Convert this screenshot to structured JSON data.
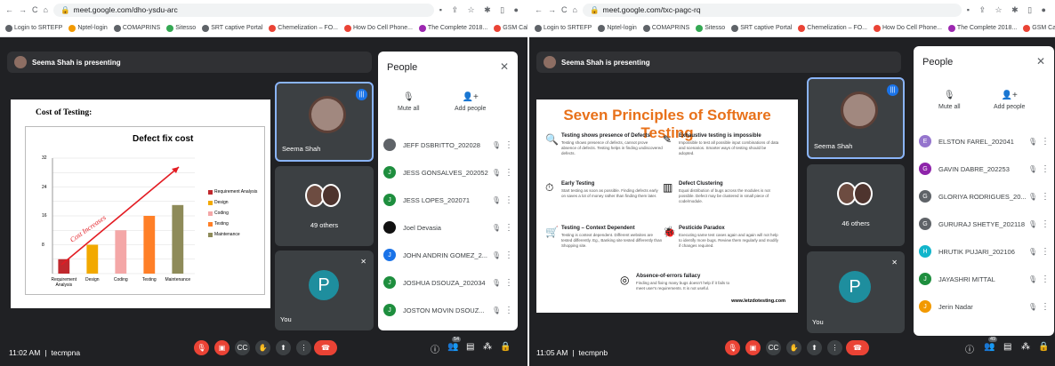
{
  "screen1": {
    "nav_icons": [
      "←",
      "→",
      "C",
      "⌂"
    ],
    "url": "meet.google.com/dho-ysdu-arc",
    "bookmarks": [
      {
        "label": "Login to SRTEFP",
        "color": "#5f6368"
      },
      {
        "label": "Nptel-login",
        "color": "#f29900"
      },
      {
        "label": "COMAPRINS",
        "color": "#5f6368"
      },
      {
        "label": "Sitesso",
        "color": "#34a853"
      },
      {
        "label": "SRT captive Portal",
        "color": "#5f6368"
      },
      {
        "label": "Chemelization – FO...",
        "color": "#ea4335"
      },
      {
        "label": "How Do Cell Phone...",
        "color": "#ea4335"
      },
      {
        "label": "The Complete 2018...",
        "color": "#9c27b0"
      },
      {
        "label": "GSM Call Flow 1 – Y...",
        "color": "#ea4335"
      },
      {
        "label": "2NE",
        "color": "#1a73e8"
      }
    ],
    "presenting": "Seema Shah is presenting",
    "slide_title": "Cost of Testing:",
    "chart_data": {
      "type": "bar",
      "title": "Defect fix cost",
      "categories": [
        "Requirement Analysis",
        "Design",
        "Coding",
        "Testing",
        "Maintenance"
      ],
      "values": [
        4,
        8,
        12,
        16,
        19
      ],
      "colors": [
        "#c0282d",
        "#f2a900",
        "#f4a7a7",
        "#ff7f27",
        "#8e8b59"
      ],
      "ylim": [
        0,
        32
      ],
      "yticks": [
        0,
        4,
        8,
        12,
        16,
        20,
        24,
        28,
        32
      ],
      "ytick_labels": [
        "",
        "",
        "8",
        "",
        "16",
        "",
        "24",
        "",
        "32"
      ],
      "annotation": "Cost Increases",
      "legend": [
        "Requirement Analysis",
        "Design",
        "Coding",
        "Testing",
        "Maintenance"
      ]
    },
    "tile_names": {
      "presenter": "Seema Shah",
      "others": "49 others",
      "you": "You"
    },
    "you_initial": "P",
    "people": {
      "title": "People",
      "close": "✕",
      "mute_all": "Mute all",
      "add_people": "Add people",
      "rows": [
        {
          "initial": "",
          "name": "JEFF DSBRITTO_202028",
          "color": "#5f6368"
        },
        {
          "initial": "J",
          "name": "JESS GONSALVES_202052",
          "color": "#1e8e3e"
        },
        {
          "initial": "J",
          "name": "JESS LOPES_202071",
          "color": "#1e8e3e"
        },
        {
          "initial": "",
          "name": "Joel Devasia",
          "color": "#111111"
        },
        {
          "initial": "J",
          "name": "JOHN ANDRIN GOMEZ_2...",
          "color": "#1a73e8"
        },
        {
          "initial": "J",
          "name": "JOSHUA DSOUZA_202034",
          "color": "#1e8e3e"
        },
        {
          "initial": "J",
          "name": "JOSTON MOVIN DSOUZ...",
          "color": "#1e8e3e"
        }
      ]
    },
    "bottom": {
      "time": "11:02 AM",
      "sep": "|",
      "code": "tecmpna",
      "badge": "54"
    }
  },
  "screen2": {
    "url": "meet.google.com/txc-pagc-rq",
    "bookmarks": [
      {
        "label": "Login to SRTEFP",
        "color": "#5f6368"
      },
      {
        "label": "Nptel-login",
        "color": "#5f6368"
      },
      {
        "label": "COMAPRINS",
        "color": "#5f6368"
      },
      {
        "label": "Sitesso",
        "color": "#34a853"
      },
      {
        "label": "SRT captive Portal",
        "color": "#5f6368"
      },
      {
        "label": "Chemelization – FO...",
        "color": "#ea4335"
      },
      {
        "label": "How Do Cell Phone...",
        "color": "#ea4335"
      },
      {
        "label": "The Complete 2018...",
        "color": "#9c27b0"
      },
      {
        "label": "GSM Call Flow 1 – Y...",
        "color": "#ea4335"
      },
      {
        "label": "2NE",
        "color": "#1a73e8"
      }
    ],
    "presenting": "Seema Shah is presenting",
    "slide_title": "Seven Principles of Software Testing",
    "principles": [
      {
        "title": "Testing shows presence of Defects",
        "body": "Testing shows presence of defects, cannot prove absence of defects. Testing helps in finding undiscovered defects."
      },
      {
        "title": "Exhaustive testing is impossible",
        "body": "Impossible to test all possible input combinations of data and scenarios. Smarter ways of testing should be adopted."
      },
      {
        "title": "Early Testing",
        "body": "Start testing as soon as possible. Finding defects early on saves a lot of money rather than finding them later."
      },
      {
        "title": "Defect Clustering",
        "body": "Equal distribution of bugs across the modules is not possible. Defect may be clustered in small piece of code/module."
      },
      {
        "title": "Testing – Context Dependent",
        "body": "Testing is context dependent. Different websites are tested differently. Eg., Banking site tested differently than Shopping site."
      },
      {
        "title": "Pesticide Paradox",
        "body": "Executing same test cases again and again will not help to identify more bugs. Review them regularly and modify if changes required."
      },
      {
        "title": "Absence-of-errors fallacy",
        "body": "Finding and fixing many bugs doesn't help if it fails to meet user's requirements. It is not useful."
      }
    ],
    "site": "www.letzdotesting.com",
    "tile_names": {
      "presenter": "Seema Shah",
      "others": "46 others",
      "you": "You"
    },
    "you_initial": "P",
    "people": {
      "title": "People",
      "close": "✕",
      "mute_all": "Mute all",
      "add_people": "Add people",
      "rows": [
        {
          "initial": "E",
          "name": "ELSTON FAREL_202041",
          "color": "#9575cd"
        },
        {
          "initial": "G",
          "name": "GAVIN DABRE_202253",
          "color": "#8e24aa"
        },
        {
          "initial": "G",
          "name": "GLORIYA RODRIGUES_20...",
          "color": "#5f6368"
        },
        {
          "initial": "G",
          "name": "GURURAJ SHETYE_202118",
          "color": "#5f6368"
        },
        {
          "initial": "H",
          "name": "HRUTIK PUJARI_202106",
          "color": "#12b5cb"
        },
        {
          "initial": "J",
          "name": "JAYASHRI MITTAL",
          "color": "#1e8e3e"
        },
        {
          "initial": "J",
          "name": "Jerin Nadar",
          "color": "#f29900"
        }
      ]
    },
    "bottom": {
      "time": "11:05 AM",
      "sep": "|",
      "code": "tecmpnb",
      "badge": "49"
    }
  }
}
